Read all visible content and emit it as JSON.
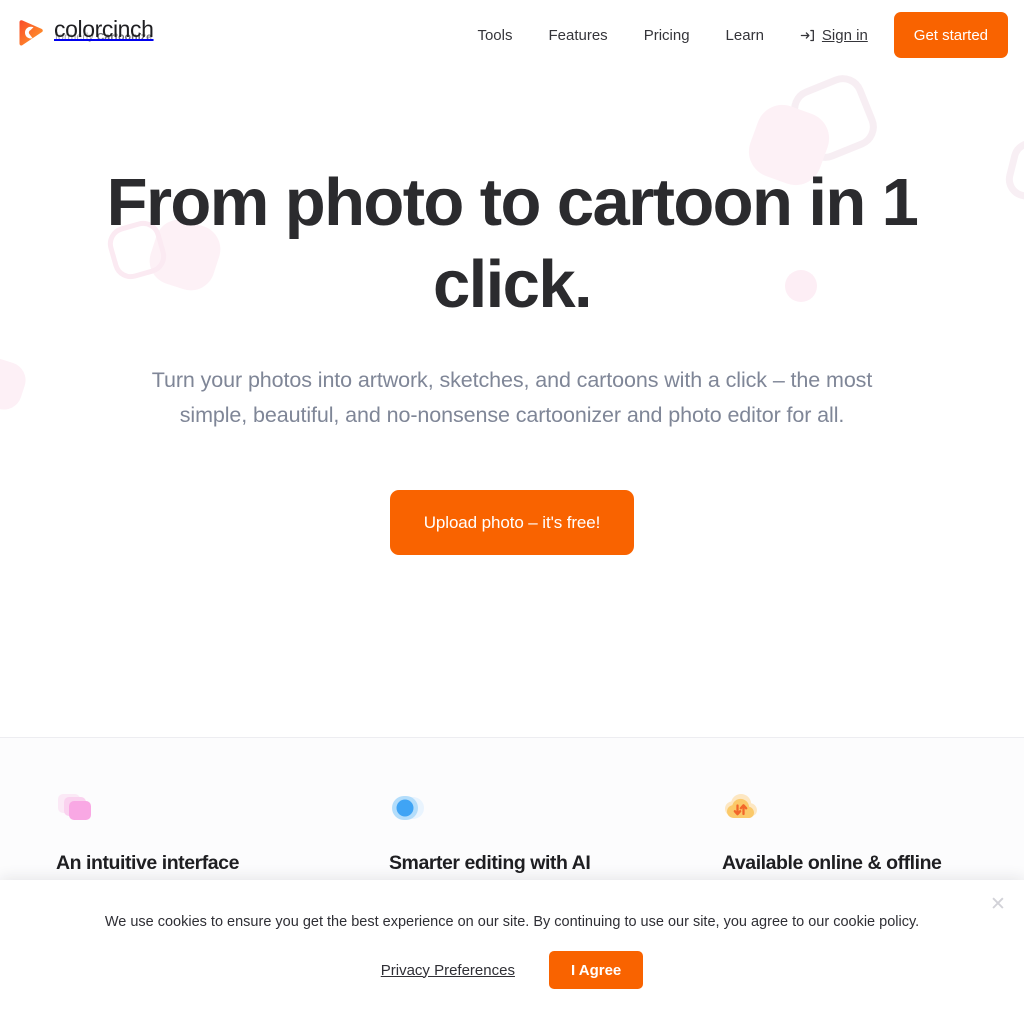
{
  "brand": {
    "name": "colorcinch",
    "tagline_prefix": "formerly ",
    "tagline_bold": "Cartoonize",
    "logo_icon": "colorcinch-c-mark-icon",
    "accent_color": "#f96300"
  },
  "header": {
    "nav_links": [
      {
        "label": "Tools",
        "name": "nav-link-tools"
      },
      {
        "label": "Features",
        "name": "nav-link-features"
      },
      {
        "label": "Pricing",
        "name": "nav-link-pricing"
      },
      {
        "label": "Learn",
        "name": "nav-link-learn"
      }
    ],
    "signin_label": "Sign in",
    "signin_icon": "sign-in-arrow-icon",
    "get_started_label": "Get started"
  },
  "hero": {
    "title": "From photo to cartoon in 1 click.",
    "subtitle": "Turn your photos into artwork, sketches, and cartoons with a click – the most simple, beautiful, and no-nonsense cartoonizer and photo editor for all.",
    "cta_label": "Upload photo – it's free!"
  },
  "features": [
    {
      "title": "An intuitive interface",
      "icon": "stacked-layers-icon",
      "icon_color": "#f9a8e0"
    },
    {
      "title": "Smarter editing with AI",
      "icon": "toggle-circle-icon",
      "icon_color": "#3fa9f5"
    },
    {
      "title": "Available online & offline",
      "icon": "cloud-sync-icon",
      "icon_color": "#f5a623"
    }
  ],
  "cookie_banner": {
    "message": "We use cookies to ensure you get the best experience on our site. By continuing to use our site, you agree to our cookie policy.",
    "privacy_label": "Privacy Preferences",
    "agree_label": "I Agree",
    "close_icon": "close-icon",
    "close_glyph": "✕"
  }
}
